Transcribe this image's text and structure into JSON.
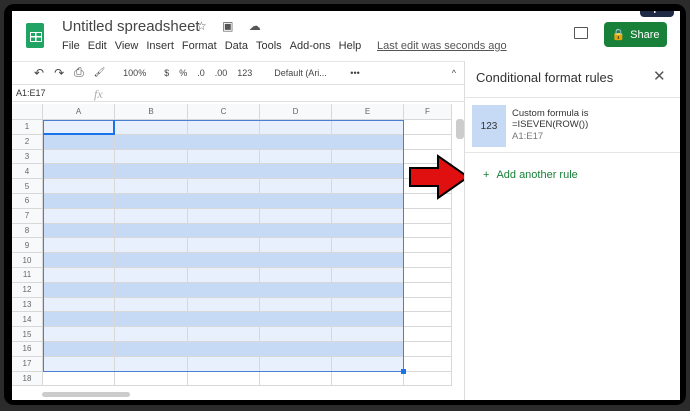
{
  "app": {
    "title": "Untitled spreadsheet",
    "title_icons": "☆ ▣ ☁",
    "menu": [
      "File",
      "Edit",
      "View",
      "Insert",
      "Format",
      "Data",
      "Tools",
      "Add-ons",
      "Help"
    ],
    "last_edit": "Last edit was seconds ago",
    "share_label": "Share",
    "watermark": "alphr"
  },
  "toolbar": {
    "undo": "↶",
    "redo": "↷",
    "print": "⎙",
    "paint": "🖌",
    "zoom": "100%",
    "currency": "$",
    "percent": "%",
    "dec_less": ".0",
    "dec_more": ".00",
    "format_num": "123",
    "font": "Default (Ari...",
    "more": "•••",
    "collapse": "^"
  },
  "formula_bar": {
    "name_box": "A1:E17",
    "fx": "fx",
    "value": ""
  },
  "grid": {
    "columns": [
      "A",
      "B",
      "C",
      "D",
      "E",
      "F"
    ],
    "rows": [
      "1",
      "2",
      "3",
      "4",
      "5",
      "6",
      "7",
      "8",
      "9",
      "10",
      "11",
      "12",
      "13",
      "14",
      "15",
      "16",
      "17",
      "18"
    ],
    "selection": "A1:E17",
    "colors": {
      "even": "#c6d9f5",
      "odd": "#e8f0fd"
    }
  },
  "panel": {
    "title": "Conditional format rules",
    "close": "✕",
    "rule": {
      "preview": "123",
      "condition": "Custom formula is",
      "formula": "=ISEVEN(ROW())",
      "range": "A1:E17"
    },
    "add_label": "Add another rule",
    "add_icon": "+"
  },
  "annotation": {
    "arrow_color": "#e01010"
  }
}
